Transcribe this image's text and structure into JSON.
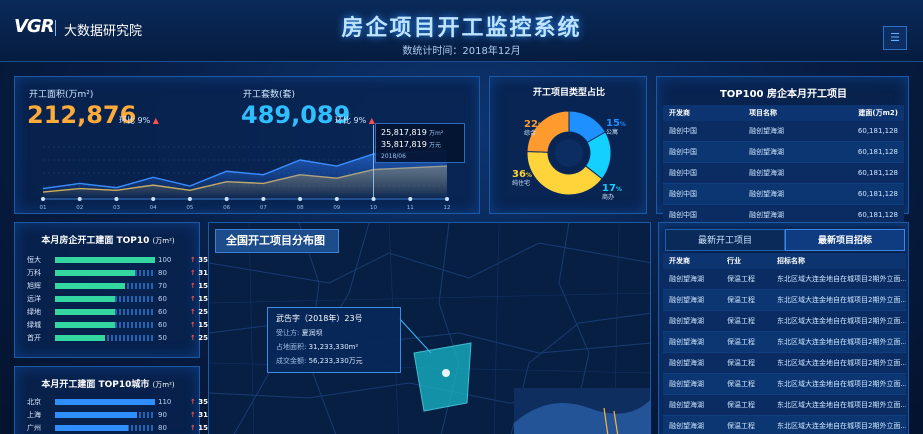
{
  "header": {
    "logo": "VGR",
    "org": "大数据研究院",
    "title": "房企项目开工监控系统",
    "subtitle": "数统计时间：2018年12月",
    "menu_icon": "list-icon"
  },
  "kpi": {
    "area_label": "开工面积(万m²)",
    "area_value": "212,876",
    "area_change_label": "环比 9%",
    "sets_label": "开工套数(套)",
    "sets_value": "489,089",
    "sets_change_label": "环比 9%"
  },
  "trend_chart": {
    "x_labels": [
      "01",
      "02",
      "03",
      "04",
      "05",
      "06",
      "07",
      "08",
      "09",
      "10",
      "11",
      "12"
    ],
    "series_a": [
      12,
      18,
      13,
      25,
      15,
      32,
      28,
      45,
      38,
      52,
      54,
      56
    ],
    "series_b": [
      8,
      12,
      10,
      16,
      10,
      20,
      18,
      28,
      24,
      34,
      36,
      38
    ],
    "tooltip": {
      "value1": "25,817,819",
      "unit1": "万m²",
      "value2": "35,817,819",
      "unit2": "万元",
      "date": "2018/06"
    }
  },
  "chart_data": {
    "type": "pie",
    "title": "开工项目类型占比",
    "slices": [
      {
        "label": "公寓",
        "value": 15,
        "color": "#1e90ff"
      },
      {
        "label": "商办",
        "value": 17,
        "color": "#14d0ff"
      },
      {
        "label": "纯住宅",
        "value": 36,
        "color": "#ffd43a"
      },
      {
        "label": "综合",
        "value": 22,
        "color": "#ff9a2e"
      }
    ]
  },
  "top100": {
    "title": "TOP100 房企本月开工项目",
    "headers": [
      "开发商",
      "项目名称",
      "建面(万m2)"
    ],
    "rows": [
      [
        "融创中国",
        "融创望海湖",
        "60,181,128"
      ],
      [
        "融创中国",
        "融创望海湖",
        "60,181,128"
      ],
      [
        "融创中国",
        "融创望海湖",
        "60,181,128"
      ],
      [
        "融创中国",
        "融创望海湖",
        "60,181,128"
      ],
      [
        "融创中国",
        "融创望海湖",
        "60,181,128"
      ]
    ]
  },
  "top10_companies": {
    "title": "本月房企开工建面 TOP10",
    "title_unit": "(万m²)",
    "items": [
      {
        "name": "恒大",
        "value": "100",
        "fraction": 1.0,
        "pct": "35%"
      },
      {
        "name": "万科",
        "value": "80",
        "fraction": 0.8,
        "pct": "31%"
      },
      {
        "name": "旭辉",
        "value": "70",
        "fraction": 0.7,
        "pct": "15%"
      },
      {
        "name": "远洋",
        "value": "60",
        "fraction": 0.6,
        "pct": "15%"
      },
      {
        "name": "绿地",
        "value": "60",
        "fraction": 0.6,
        "pct": "25%"
      },
      {
        "name": "绿城",
        "value": "60",
        "fraction": 0.6,
        "pct": "15%"
      },
      {
        "name": "首开",
        "value": "50",
        "fraction": 0.5,
        "pct": "25%"
      }
    ],
    "up_icon": "↑"
  },
  "top10_cities": {
    "title": "本月开工建面 TOP10城市",
    "title_unit": "(万m²)",
    "items": [
      {
        "name": "北京",
        "value": "110",
        "fraction": 1.0,
        "pct": "35%"
      },
      {
        "name": "上海",
        "value": "90",
        "fraction": 0.82,
        "pct": "31%"
      },
      {
        "name": "广州",
        "value": "80",
        "fraction": 0.73,
        "pct": "15%"
      }
    ]
  },
  "map": {
    "title": "全国开工项目分布图",
    "popup": {
      "title": "武告字（2018年）23号",
      "rows": [
        {
          "label": "受让方:",
          "value": "夏润坝"
        },
        {
          "label": "占地面积:",
          "value": "31,233,330m²"
        },
        {
          "label": "成交金额:",
          "value": "56,233,330万元"
        }
      ]
    }
  },
  "bidding": {
    "tab1": "最新开工项目",
    "tab2": "最新项目招标",
    "headers": [
      "开发商",
      "行业",
      "招标名称"
    ],
    "rows": [
      [
        "融创望海湖",
        "保温工程",
        "东北区域大连金地自在城项目2期外立面..."
      ],
      [
        "融创望海湖",
        "保温工程",
        "东北区域大连金地自在城项目2期外立面..."
      ],
      [
        "融创望海湖",
        "保温工程",
        "东北区域大连金地自在城项目2期外立面..."
      ],
      [
        "融创望海湖",
        "保温工程",
        "东北区域大连金地自在城项目2期外立面..."
      ],
      [
        "融创望海湖",
        "保温工程",
        "东北区域大连金地自在城项目2期外立面..."
      ],
      [
        "融创望海湖",
        "保温工程",
        "东北区域大连金地自在城项目2期外立面..."
      ],
      [
        "融创望海湖",
        "保温工程",
        "东北区域大连金地自在城项目2期外立面..."
      ],
      [
        "融创望海湖",
        "保温工程",
        "东北区域大连金地自在城项目2期外立面..."
      ]
    ]
  }
}
